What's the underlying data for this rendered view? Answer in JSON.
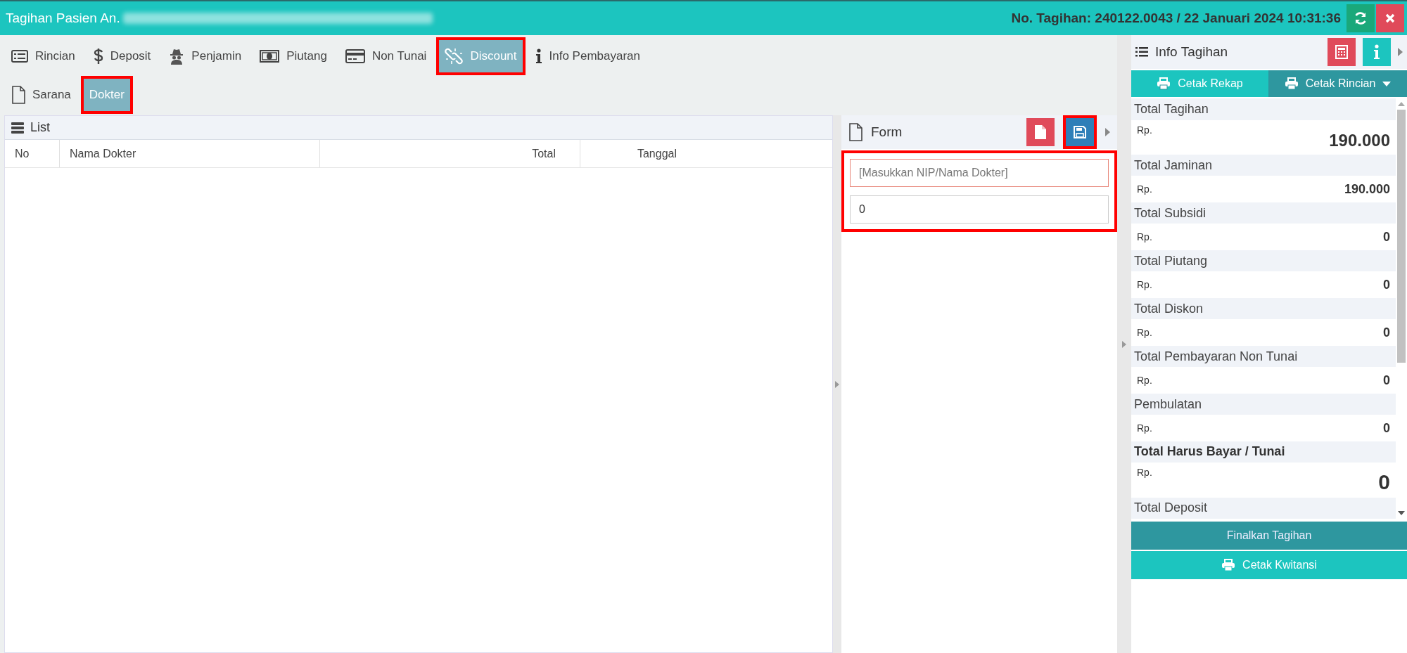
{
  "window": {
    "title": "Tagihan Pasien An.",
    "bill_info": "No. Tagihan: 240122.0043 / 22 Januari 2024 10:31:36"
  },
  "tabs": [
    {
      "label": "Rincian",
      "selected": false,
      "annotated": false
    },
    {
      "label": "Deposit",
      "selected": false,
      "annotated": false
    },
    {
      "label": "Penjamin",
      "selected": false,
      "annotated": false
    },
    {
      "label": "Piutang",
      "selected": false,
      "annotated": false
    },
    {
      "label": "Non Tunai",
      "selected": false,
      "annotated": false
    },
    {
      "label": "Discount",
      "selected": true,
      "annotated": true
    },
    {
      "label": "Info Pembayaran",
      "selected": false,
      "annotated": false
    }
  ],
  "subtabs": [
    {
      "label": "Sarana",
      "selected": false,
      "annotated": false
    },
    {
      "label": "Dokter",
      "selected": true,
      "annotated": true
    }
  ],
  "list": {
    "title": "List",
    "columns": [
      "No",
      "Nama Dokter",
      "Total",
      "Tanggal"
    ]
  },
  "form": {
    "title": "Form",
    "save_annotated": true,
    "fields_annotated": true,
    "fields": [
      {
        "placeholder": "[Masukkan NIP/Nama Dokter]",
        "invalid": true
      },
      {
        "value": "0",
        "invalid": false
      }
    ]
  },
  "info": {
    "title": "Info Tagihan",
    "print_buttons": [
      "Cetak Rekap",
      "Cetak Rincian"
    ],
    "items": [
      {
        "label": "Total Tagihan",
        "currency": "Rp.",
        "value": "190.000",
        "kind": "large"
      },
      {
        "label": "Total Jaminan",
        "currency": "Rp.",
        "value": "190.000",
        "kind": "normal"
      },
      {
        "label": "Total Subsidi",
        "currency": "Rp.",
        "value": "0",
        "kind": "normal"
      },
      {
        "label": "Total Piutang",
        "currency": "Rp.",
        "value": "0",
        "kind": "normal"
      },
      {
        "label": "Total Diskon",
        "currency": "Rp.",
        "value": "0",
        "kind": "normal"
      },
      {
        "label": "Total Pembayaran Non Tunai",
        "currency": "Rp.",
        "value": "0",
        "kind": "normal"
      },
      {
        "label": "Pembulatan",
        "currency": "Rp.",
        "value": "0",
        "kind": "normal"
      },
      {
        "label": "Total Harus Bayar / Tunai",
        "currency": "Rp.",
        "value": "0",
        "kind": "grand"
      },
      {
        "label": "Total Deposit",
        "kind": "label"
      }
    ],
    "finalize_button": "Finalkan Tagihan",
    "receipt_button": "Cetak Kwitansi"
  }
}
